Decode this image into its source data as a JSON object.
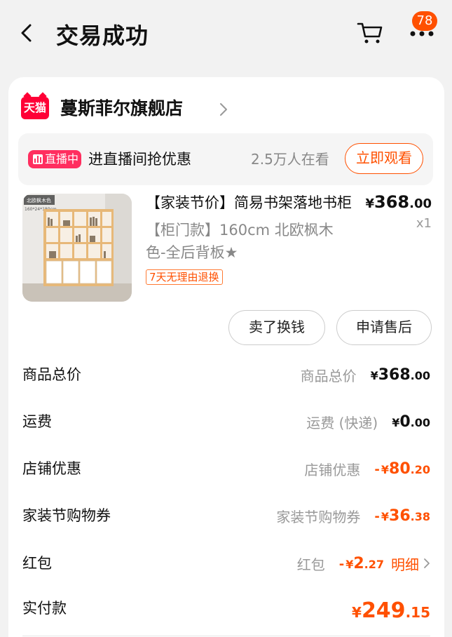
{
  "header": {
    "title": "交易成功",
    "more_badge": "78",
    "back_icon": "chevron-left-icon",
    "cart_icon": "cart-icon",
    "more_icon": "more-dots-icon"
  },
  "shop": {
    "logo_text": "天猫",
    "name": "蔓斯菲尔旗舰店"
  },
  "live": {
    "badge": "直播中",
    "text": "进直播间抢优惠",
    "viewers": "2.5万人在看",
    "button": "立即观看"
  },
  "product": {
    "image_caption": "北欧枫木色",
    "image_size_text": "160*24*180cm",
    "title": "【家装节价】简易书架落地书柜",
    "price_yen": "¥",
    "price_int": "368",
    "price_dec": ".00",
    "qty": "x1",
    "spec": "【柜门款】160cm 北欧枫木色-全后背板★",
    "return_tag": "7天无理由退换"
  },
  "actions": {
    "sell": "卖了换钱",
    "aftersale": "申请售后"
  },
  "fees": {
    "goods_total": {
      "label": "商品总价",
      "sub": "商品总价",
      "yen": "¥",
      "int": "368",
      "dec": ".00"
    },
    "shipping": {
      "label": "运费",
      "sub": "运费 (快递)",
      "yen": "¥",
      "int": "0",
      "dec": ".00"
    },
    "shop_discount": {
      "label": "店铺优惠",
      "sub": "店铺优惠",
      "minus": "-",
      "yen": "¥",
      "int": "80",
      "dec": ".20"
    },
    "coupon": {
      "label": "家装节购物券",
      "sub": "家装节购物券",
      "minus": "-",
      "yen": "¥",
      "int": "36",
      "dec": ".38"
    },
    "red_packet": {
      "label": "红包",
      "sub": "红包",
      "minus": "-",
      "yen": "¥",
      "int": "2",
      "dec": ".27",
      "link": "明细"
    },
    "paid": {
      "label": "实付款",
      "yen": "¥",
      "int": "249",
      "dec": ".15"
    }
  },
  "colors": {
    "accent": "#ff5000",
    "live_badge": "#ff2e5f",
    "tmall": "#ff0036"
  }
}
